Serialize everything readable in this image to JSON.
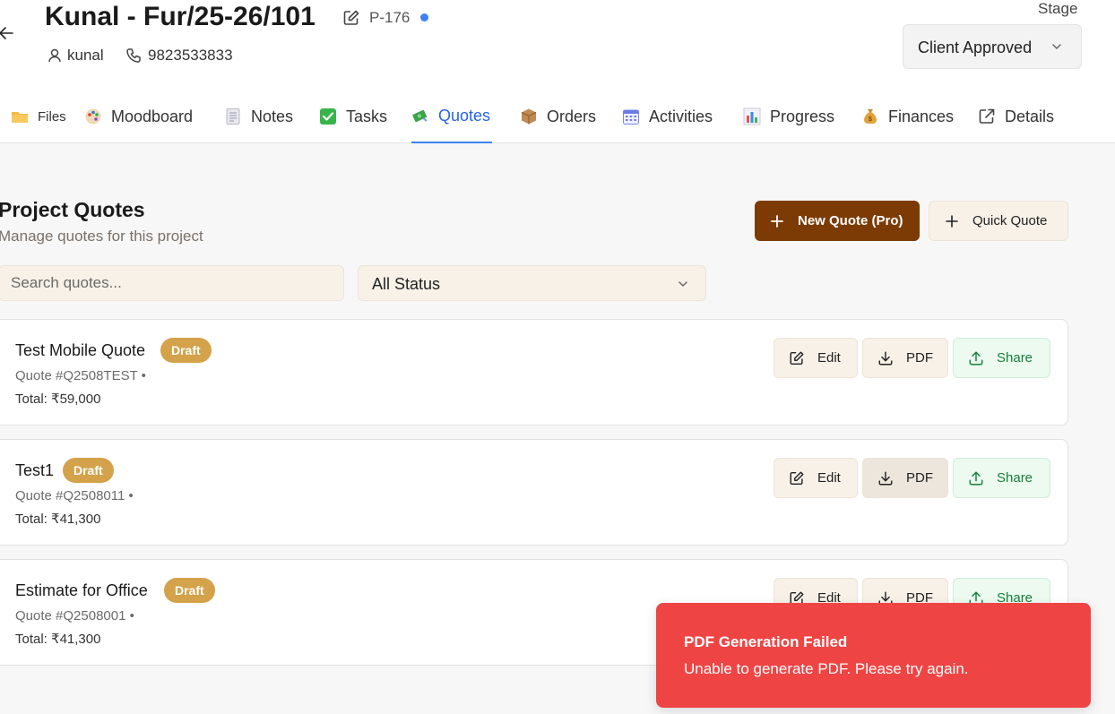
{
  "header": {
    "title": "Kunal - Fur/25-26/101",
    "project_id": "P-176",
    "user": "kunal",
    "phone": "9823533833",
    "stage_label": "Stage",
    "stage_value": "Client Approved",
    "status_dot_color": "#3b82f6"
  },
  "tabs": [
    {
      "label": "Files",
      "icon": "folder-icon"
    },
    {
      "label": "Moodboard",
      "icon": "palette-icon"
    },
    {
      "label": "Notes",
      "icon": "note-icon"
    },
    {
      "label": "Tasks",
      "icon": "checkbox-icon"
    },
    {
      "label": "Quotes",
      "icon": "money-icon",
      "active": true
    },
    {
      "label": "Orders",
      "icon": "package-icon"
    },
    {
      "label": "Activities",
      "icon": "calendar-icon"
    },
    {
      "label": "Progress",
      "icon": "bar-chart-icon"
    },
    {
      "label": "Finances",
      "icon": "money-bag-icon"
    },
    {
      "label": "Details",
      "icon": "external-link-icon"
    }
  ],
  "section": {
    "title": "Project Quotes",
    "subtitle": "Manage quotes for this project",
    "new_quote_label": "New Quote (Pro)",
    "quick_quote_label": "Quick Quote"
  },
  "filters": {
    "search_placeholder": "Search quotes...",
    "status_value": "All Status"
  },
  "quotes": [
    {
      "name": "Test Mobile Quote",
      "status": "Draft",
      "quote_no": "Quote #Q2508TEST •",
      "total": "Total: ₹59,000"
    },
    {
      "name": "Test1",
      "status": "Draft",
      "quote_no": "Quote #Q2508011 •",
      "total": "Total: ₹41,300"
    },
    {
      "name": "Estimate for Office",
      "status": "Draft",
      "quote_no": "Quote #Q2508001 •",
      "total": "Total: ₹41,300"
    }
  ],
  "actions": {
    "edit": "Edit",
    "pdf": "PDF",
    "share": "Share"
  },
  "toast": {
    "title": "PDF Generation Failed",
    "message": "Unable to generate PDF. Please try again."
  },
  "colors": {
    "primary_button": "#7c3b05",
    "badge": "#d4a24a",
    "toast": "#ef4444",
    "active_tab": "#2563eb"
  }
}
